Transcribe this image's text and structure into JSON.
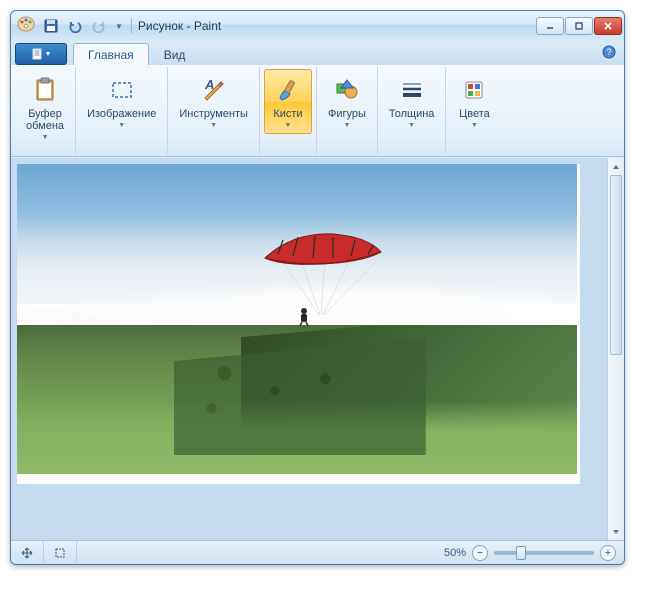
{
  "window": {
    "title": "Рисунок - Paint"
  },
  "ribbon": {
    "tabs": {
      "home": "Главная",
      "view": "Вид"
    },
    "groups": {
      "clipboard": "Буфер\nобмена",
      "image": "Изображение",
      "tools": "Инструменты",
      "brushes": "Кисти",
      "shapes": "Фигуры",
      "size": "Толщина",
      "colors": "Цвета"
    }
  },
  "statusbar": {
    "zoom_label": "50%"
  },
  "icons": {
    "app": "paint-palette",
    "save": "floppy",
    "undo": "undo-arrow",
    "redo": "redo-arrow",
    "file_doc": "document",
    "clipboard": "clipboard",
    "select": "dashed-rect",
    "pencil": "pencil-A",
    "brush": "paintbrush",
    "shapes": "shapes-group",
    "lines": "line-weight",
    "colors": "color-swatch",
    "help": "help-circle",
    "move_cursor": "move-arrows",
    "crop_cursor": "crop"
  },
  "colors": {
    "accent": "#2b6fb0",
    "ribbon_bg": "#e4eff9",
    "active_btn": "#ffd25a"
  }
}
